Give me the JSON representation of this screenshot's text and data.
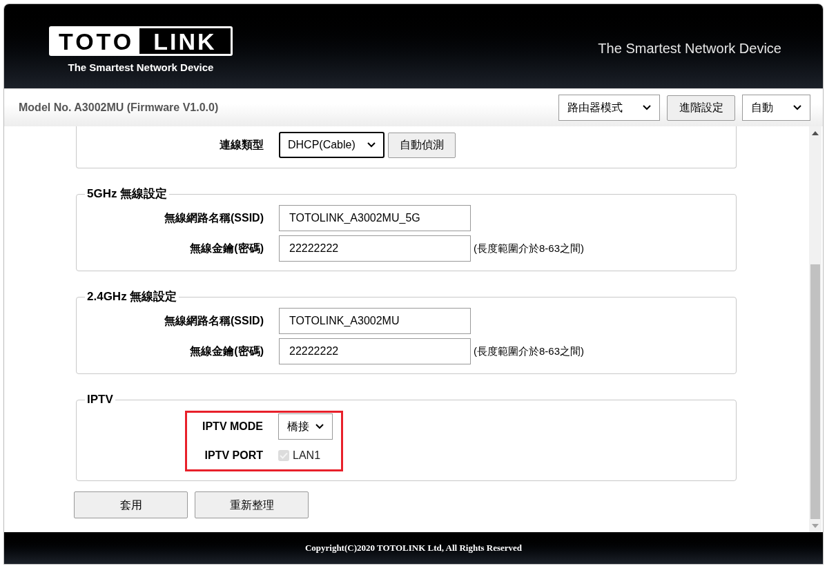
{
  "header": {
    "logo": {
      "left": "TOTO",
      "right": "LINK"
    },
    "logo_tagline": "The Smartest Network Device",
    "tagline": "The Smartest Network Device"
  },
  "toolbar": {
    "model": "Model No. A3002MU (Firmware V1.0.0)",
    "mode_select": "路由器模式",
    "advanced_button": "進階設定",
    "language_select": "自動"
  },
  "sections": [
    {
      "highlighted": false,
      "rows": [
        {
          "kind": "select",
          "label": "連線類型",
          "value": "DHCP(Cable)",
          "button": "自動偵測"
        }
      ]
    },
    {
      "legend": "5GHz 無線設定",
      "highlighted": false,
      "rows": [
        {
          "kind": "input",
          "label": "無線網路名稱(SSID)",
          "value": "TOTOLINK_A3002MU_5G"
        },
        {
          "kind": "input",
          "label": "無線金鑰(密碼)",
          "value": "22222222",
          "hint": "(長度範圍介於8-63之間)"
        }
      ]
    },
    {
      "legend": "2.4GHz 無線設定",
      "highlighted": false,
      "rows": [
        {
          "kind": "input",
          "label": "無線網路名稱(SSID)",
          "value": "TOTOLINK_A3002MU"
        },
        {
          "kind": "input",
          "label": "無線金鑰(密碼)",
          "value": "22222222",
          "hint": "(長度範圍介於8-63之間)"
        }
      ]
    },
    {
      "legend": "IPTV",
      "highlighted": true,
      "rows": [
        {
          "kind": "select",
          "label": "IPTV MODE",
          "value": "橋接"
        },
        {
          "kind": "checkbox",
          "label": "IPTV PORT",
          "text": "LAN1",
          "checked": true,
          "disabled": true
        }
      ]
    }
  ],
  "buttons": [
    "套用",
    "重新整理"
  ],
  "footer": "Copyright(C)2020 TOTOLINK Ltd, All Rights Reserved"
}
